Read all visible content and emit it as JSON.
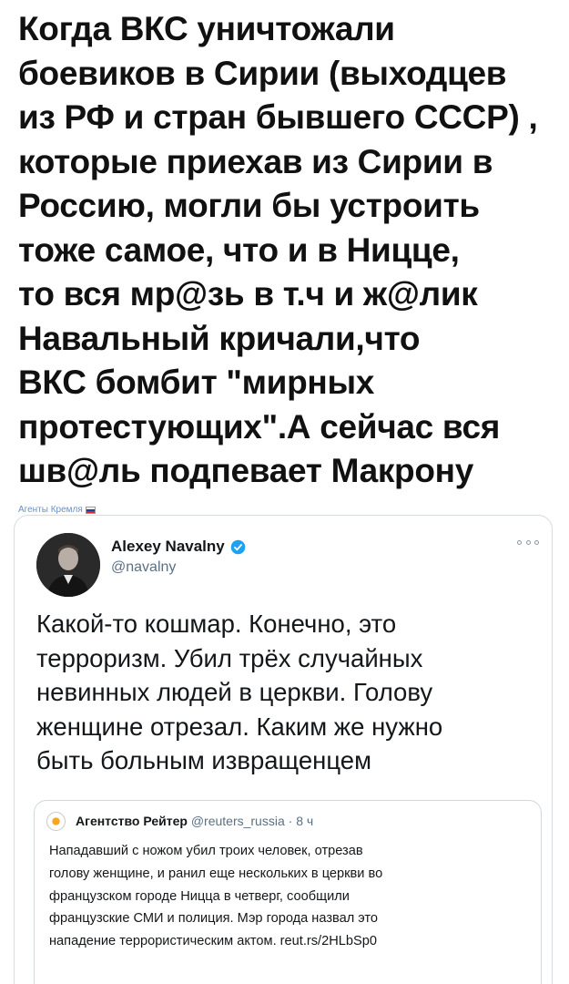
{
  "headline": {
    "lines": [
      "Когда ВКС уничтожали",
      "боевиков в Сирии (выходцев",
      "из РФ и стран бывшего СССР) ,",
      "которые приехав из Сирии в",
      "Россию, могли бы устроить",
      "тоже самое, что и в Ницце,",
      "то вся мр@зь в т.ч и ж@лик",
      "Навальный кричали,что",
      "ВКС бомбит \"мирных",
      "протестующих\".А сейчас вся",
      "шв@ль подпевает Макрону"
    ]
  },
  "watermark": {
    "text": "Агенты Кремля"
  },
  "tweet": {
    "author_name": "Alexey Navalny",
    "author_handle": "@navalny",
    "verified": true,
    "text_lines": [
      "Какой-то кошмар. Конечно, это",
      "терроризм. Убил трёх случайных",
      "невинных людей в церкви. Голову",
      "женщине отрезал. Каким же нужно",
      "быть больным извращенцем"
    ],
    "quoted": {
      "author_name": "Агентство Рейтер",
      "author_handle": "@reuters_russia",
      "separator": "·",
      "time": "8 ч",
      "text_lines": [
        "Нападавший с ножом убил троих человек, отрезав",
        "голову женщине, и ранил еще нескольких в церкви во",
        "французском городе Ницца в четверг, сообщили",
        "французские СМИ и полиция. Мэр города назвал это",
        "нападение террористическим актом. reut.rs/2HLbSp0"
      ]
    }
  },
  "colors": {
    "verified": "#1da1f2",
    "handle": "#5b7083",
    "watermark": "#6a8fc4",
    "card_border": "#d7dde3"
  }
}
